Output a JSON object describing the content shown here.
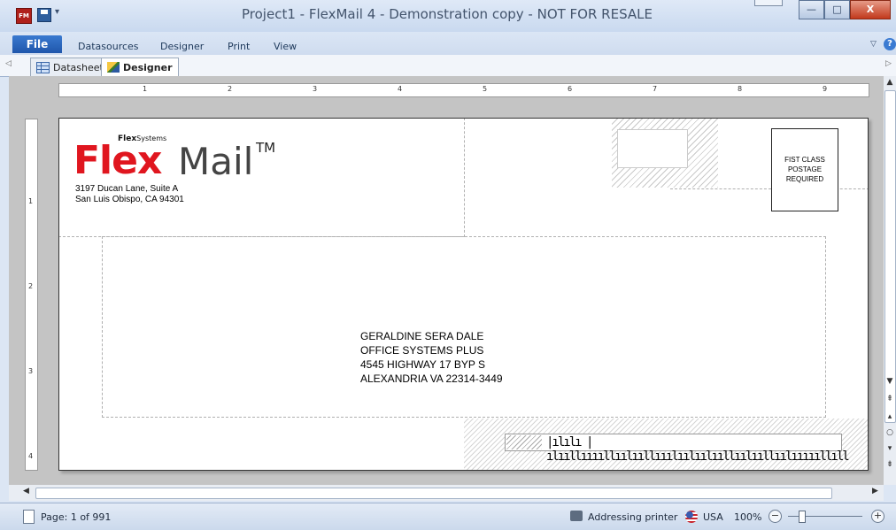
{
  "app": {
    "title": "Project1 - FlexMail 4 - Demonstration copy - NOT FOR RESALE",
    "icon_text": "FM",
    "window_buttons": {
      "minimize": "—",
      "maximize": "□",
      "close": "X"
    }
  },
  "menu": {
    "file": "File",
    "items": [
      "Datasources",
      "Designer",
      "Print",
      "View"
    ]
  },
  "tabs": [
    {
      "label": "Datasheet",
      "icon": "grid-icon"
    },
    {
      "label": "Designer",
      "icon": "designer-icon"
    }
  ],
  "ruler": {
    "horizontal": [
      "1",
      "2",
      "3",
      "4",
      "5",
      "6",
      "7",
      "8",
      "9"
    ],
    "vertical": [
      "1",
      "2",
      "3",
      "4"
    ]
  },
  "envelope": {
    "logo_brand_small": "Flex",
    "logo_brand_small_suffix": "Systems",
    "logo_flex": "Flex",
    "logo_mail": "Mail",
    "logo_tm": "TM",
    "return_address": [
      "3197 Ducan Lane, Suite A",
      "San Luis Obispo, CA 94301"
    ],
    "postage": [
      "FIST CLASS",
      "POSTAGE",
      "REQUIRED"
    ],
    "recipient": [
      "GERALDINE SERA DALE",
      "OFFICE SYSTEMS PLUS",
      "4545 HIGHWAY 17 BYP S",
      "ALEXANDRIA VA 22314-3449"
    ],
    "barcode": "|ılılı |ılııllııııllıılııllııılıılıılııllıılııllıılıııııllıll"
  },
  "status": {
    "page": "Page: 1 of 991",
    "printer": "Addressing printer",
    "country": "USA",
    "zoom": "100%"
  },
  "colors": {
    "accent": "#1f56ab",
    "logo_red": "#e0161f"
  }
}
